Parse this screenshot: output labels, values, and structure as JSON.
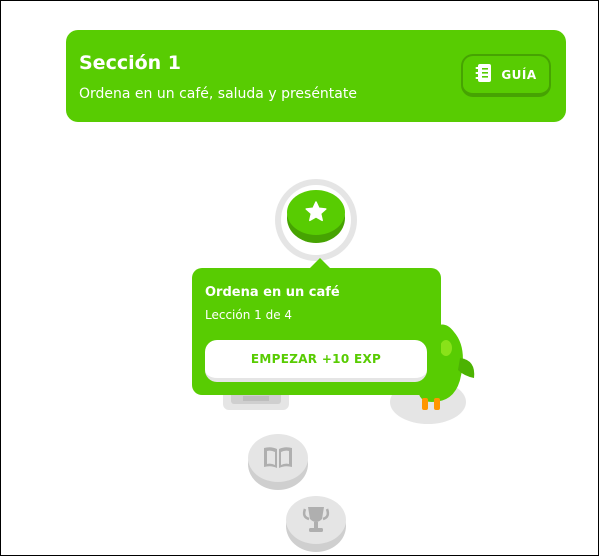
{
  "section": {
    "title": "Sección 1",
    "subtitle": "Ordena en un café, saluda y preséntate",
    "guide_button": {
      "label": "GUÍA",
      "icon": "notebook-icon"
    }
  },
  "path": {
    "current_node": {
      "icon": "star-icon",
      "state": "active"
    },
    "locked_nodes": [
      {
        "icon": "chest-icon",
        "state": "locked"
      },
      {
        "icon": "book-icon",
        "state": "locked"
      },
      {
        "icon": "trophy-icon",
        "state": "locked"
      }
    ],
    "mascot": "duo-owl-mascot"
  },
  "popover": {
    "title": "Ordena en un café",
    "progress": "Lección 1 de 4",
    "start_button": "EMPEZAR +10 EXP"
  },
  "colors": {
    "accent": "#58cc02",
    "accent_dark": "#46a302",
    "locked": "#e5e5e5",
    "locked_dark": "#cfcfcf"
  }
}
